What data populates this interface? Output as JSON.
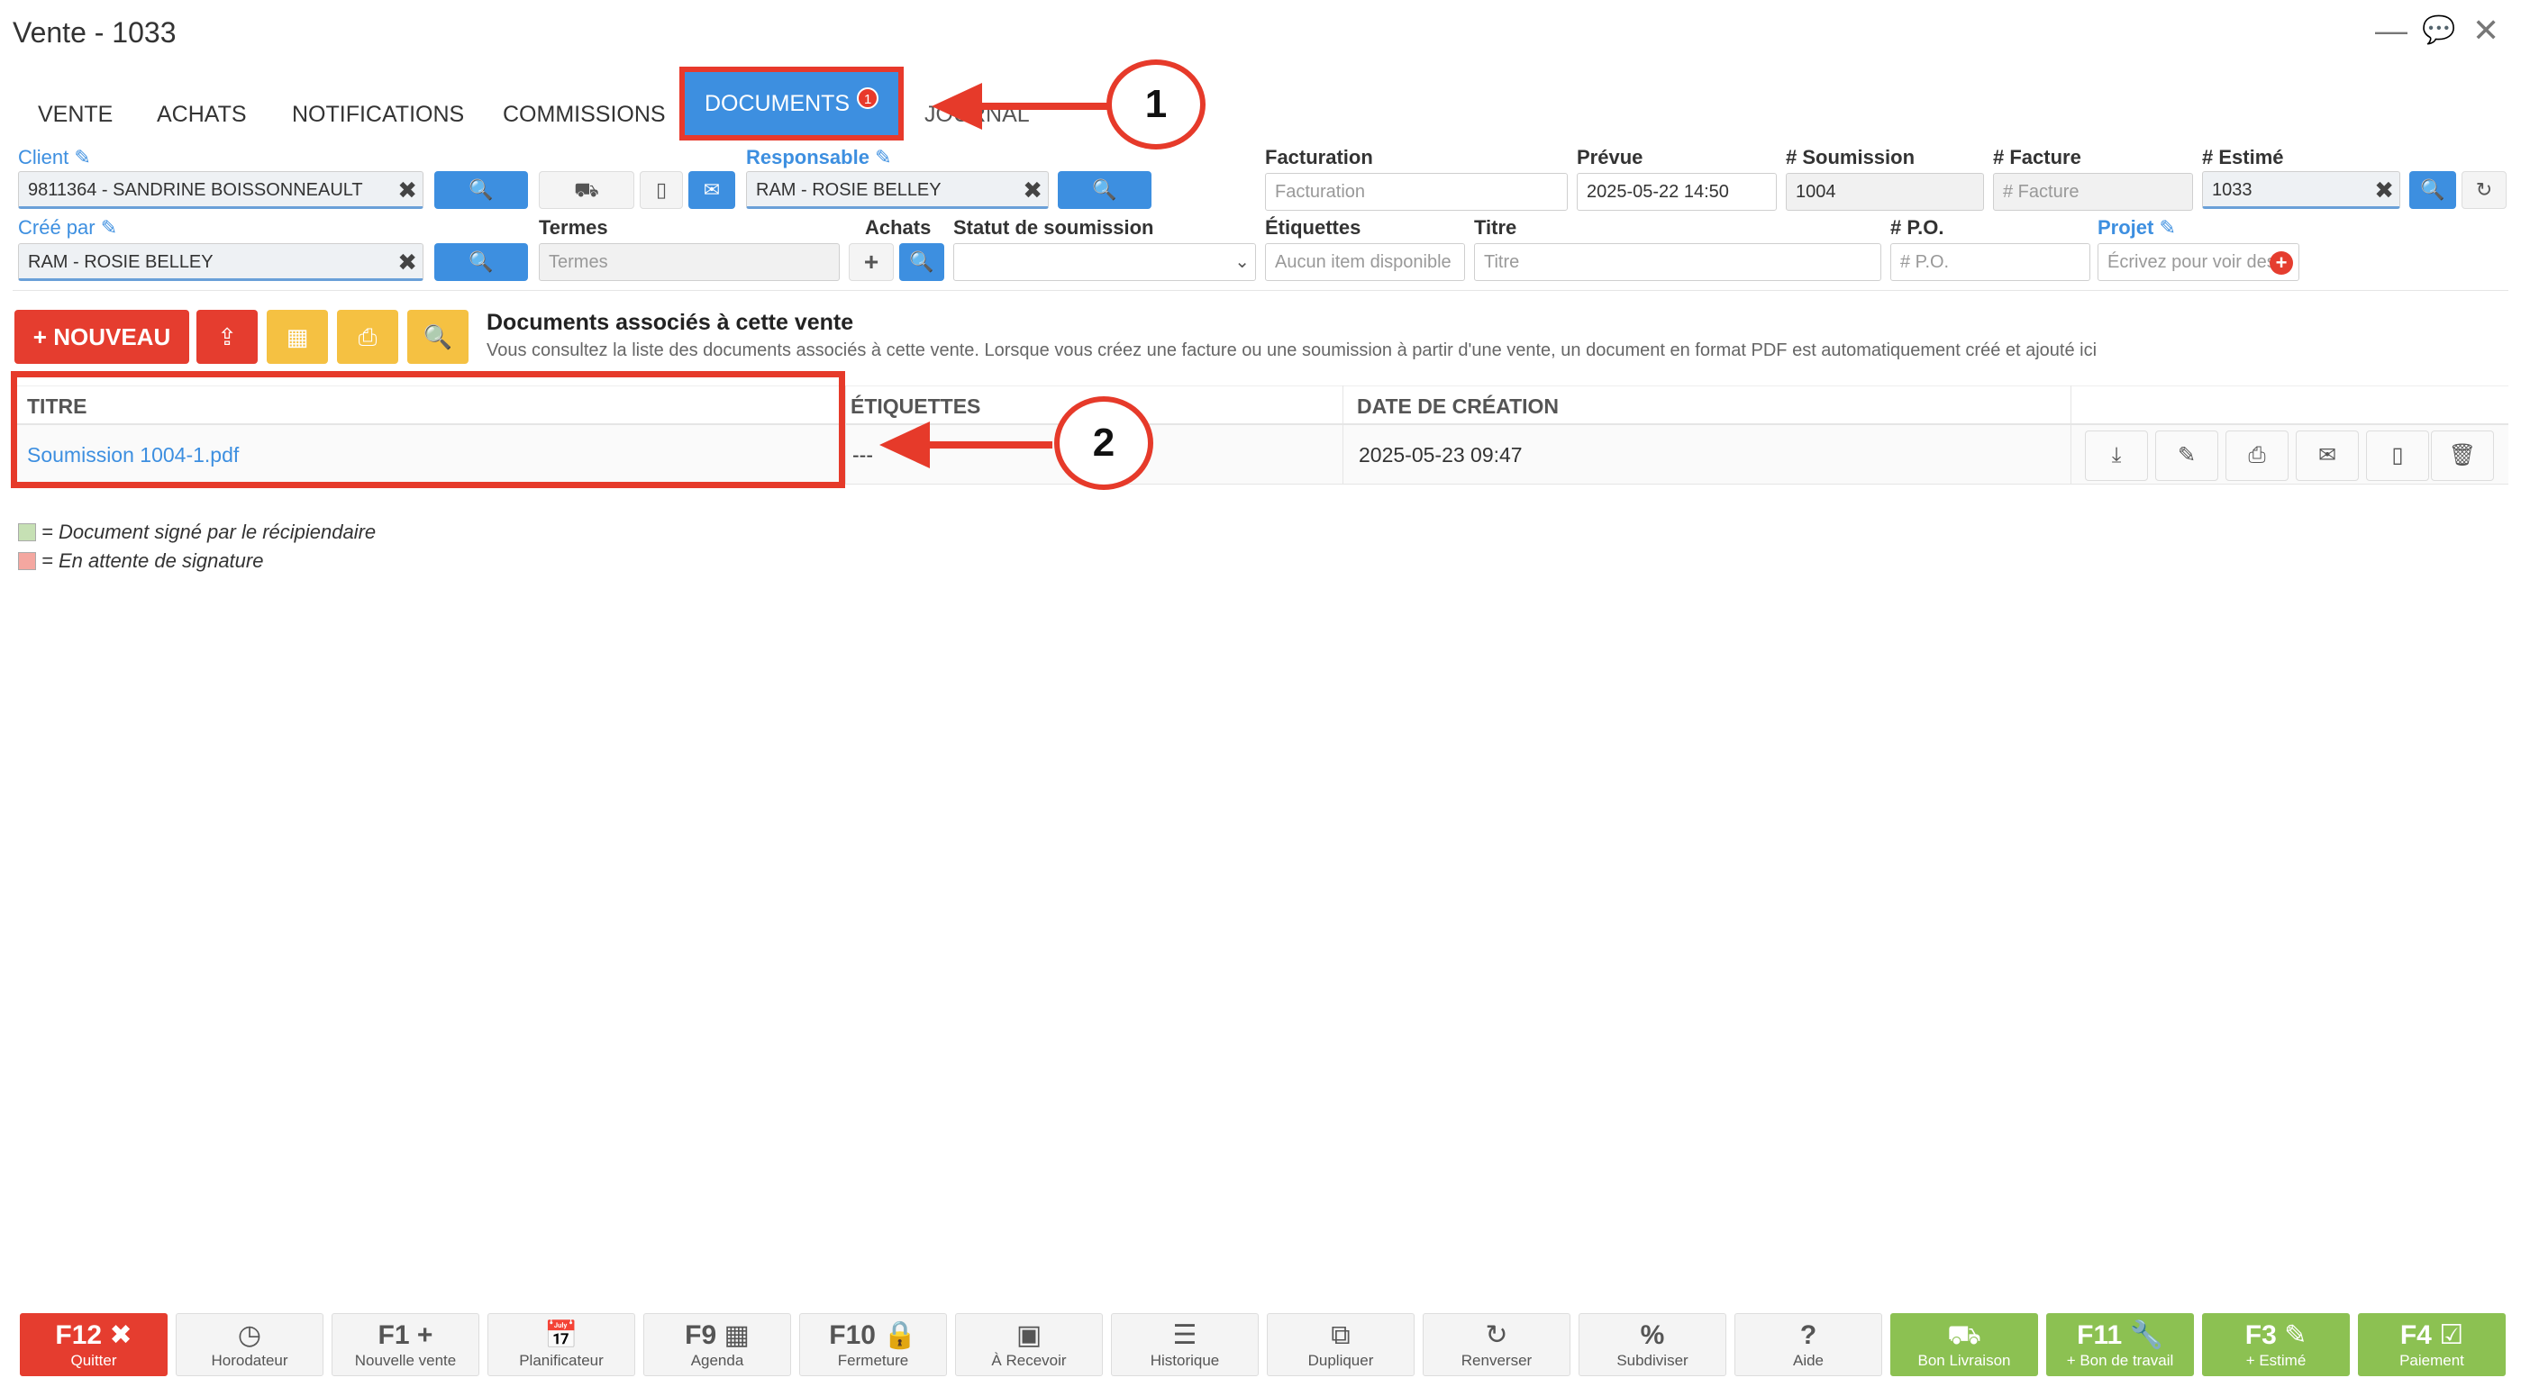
{
  "window": {
    "title": "Vente - 1033"
  },
  "tabs": [
    {
      "label": "VENTE"
    },
    {
      "label": "ACHATS"
    },
    {
      "label": "NOTIFICATIONS"
    },
    {
      "label": "COMMISSIONS"
    },
    {
      "label": "DOCUMENTS",
      "badge": "1"
    },
    {
      "label": "JOURNAL"
    }
  ],
  "annotations": {
    "one": "1",
    "two": "2"
  },
  "form": {
    "client_label": "Client",
    "client_value": "9811364 - SANDRINE BOISSONNEAULT",
    "responsable_label": "Responsable",
    "responsable_value": "RAM - ROSIE BELLEY",
    "facturation_label": "Facturation",
    "facturation_placeholder": "Facturation",
    "prevue_label": "Prévue",
    "prevue_value": "2025-05-22 14:50",
    "soumission_label": "# Soumission",
    "soumission_value": "1004",
    "facture_label": "# Facture",
    "facture_placeholder": "# Facture",
    "estime_label": "# Estimé",
    "estime_value": "1033",
    "cree_par_label": "Créé par",
    "cree_par_value": "RAM - ROSIE BELLEY",
    "termes_label": "Termes",
    "termes_placeholder": "Termes",
    "achats_label": "Achats",
    "statut_label": "Statut de soumission",
    "etiquettes_label": "Étiquettes",
    "etiquettes_placeholder": "Aucun item disponible",
    "titre_label": "Titre",
    "titre_placeholder": "Titre",
    "po_label": "# P.O.",
    "po_placeholder": "# P.O.",
    "projet_label": "Projet",
    "projet_placeholder": "Écrivez pour voir des"
  },
  "toolbar": {
    "new_label": "NOUVEAU",
    "section_title": "Documents associés à cette vente",
    "section_desc": "Vous consultez la liste des documents associés à cette vente. Lorsque vous créez une facture ou une soumission à partir d'une vente, un document en format PDF est automatiquement créé et ajouté ici"
  },
  "table": {
    "headers": [
      "TITRE",
      "ÉTIQUETTES",
      "DATE DE CRÉATION"
    ],
    "rows": [
      {
        "titre": "Soumission 1004-1.pdf",
        "etiquettes": "---",
        "date": "2025-05-23 09:47"
      }
    ]
  },
  "legend": {
    "signed": "= Document signé par le récipiendaire",
    "pending": "= En attente de signature",
    "signed_color": "#c6e0b4",
    "pending_color": "#f4a7a0"
  },
  "footer": [
    {
      "key": "F12",
      "label": "Quitter"
    },
    {
      "key": "",
      "label": "Horodateur"
    },
    {
      "key": "F1",
      "label": "Nouvelle vente"
    },
    {
      "key": "",
      "label": "Planificateur"
    },
    {
      "key": "F9",
      "label": "Agenda"
    },
    {
      "key": "F10",
      "label": "Fermeture"
    },
    {
      "key": "",
      "label": "À Recevoir"
    },
    {
      "key": "",
      "label": "Historique"
    },
    {
      "key": "",
      "label": "Dupliquer"
    },
    {
      "key": "",
      "label": "Renverser"
    },
    {
      "key": "",
      "label": "Subdiviser"
    },
    {
      "key": "",
      "label": "Aide"
    },
    {
      "key": "",
      "label": "Bon Livraison"
    },
    {
      "key": "F11",
      "label": "+ Bon de travail"
    },
    {
      "key": "F3",
      "label": "+ Estimé"
    },
    {
      "key": "F4",
      "label": "Paiement"
    }
  ],
  "colors": {
    "accent": "#3d8fe0",
    "danger": "#e53d2f",
    "warning": "#f5c142",
    "success": "#8cc152",
    "annotation": "#e63a2a"
  }
}
